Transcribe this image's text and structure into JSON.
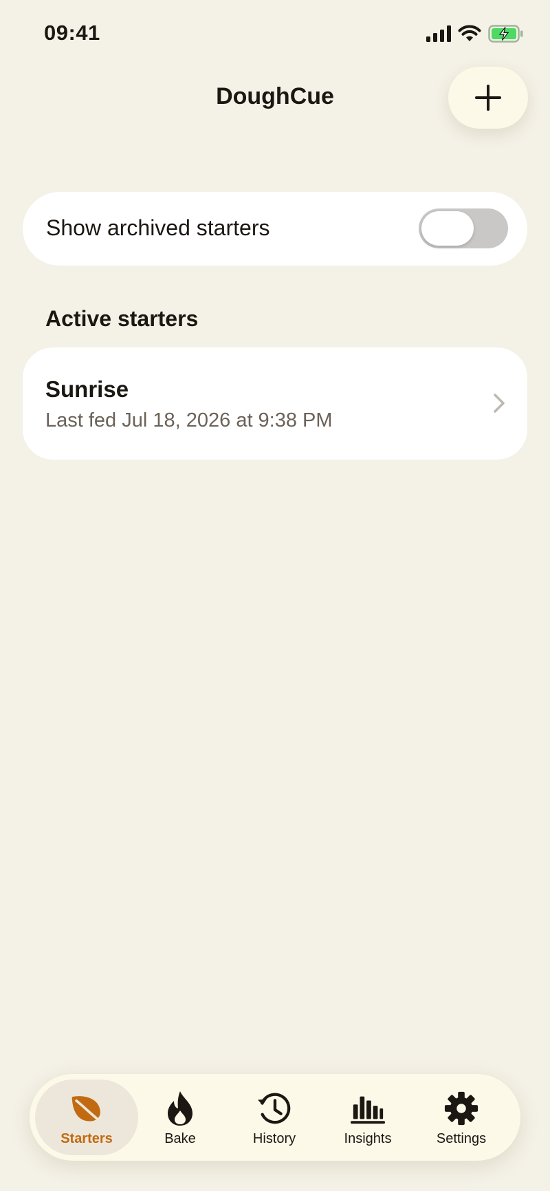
{
  "status": {
    "time": "09:41"
  },
  "header": {
    "title": "DoughCue",
    "add_icon": "plus-icon"
  },
  "archived_toggle": {
    "label": "Show archived starters",
    "on": false
  },
  "active_section": {
    "title": "Active starters",
    "starters": [
      {
        "name": "Sunrise",
        "subtitle": "Last fed Jul 18, 2026 at 9:38 PM"
      }
    ]
  },
  "tabs": [
    {
      "label": "Starters",
      "icon": "leaf-icon",
      "active": true
    },
    {
      "label": "Bake",
      "icon": "flame-icon",
      "active": false
    },
    {
      "label": "History",
      "icon": "history-clock-icon",
      "active": false
    },
    {
      "label": "Insights",
      "icon": "bar-chart-icon",
      "active": false
    },
    {
      "label": "Settings",
      "icon": "gear-icon",
      "active": false
    }
  ],
  "colors": {
    "background": "#f4f1e6",
    "accent": "#c26a12",
    "card": "#ffffff",
    "tab_bar": "#fdf9e8",
    "battery_green": "#4cd964"
  }
}
